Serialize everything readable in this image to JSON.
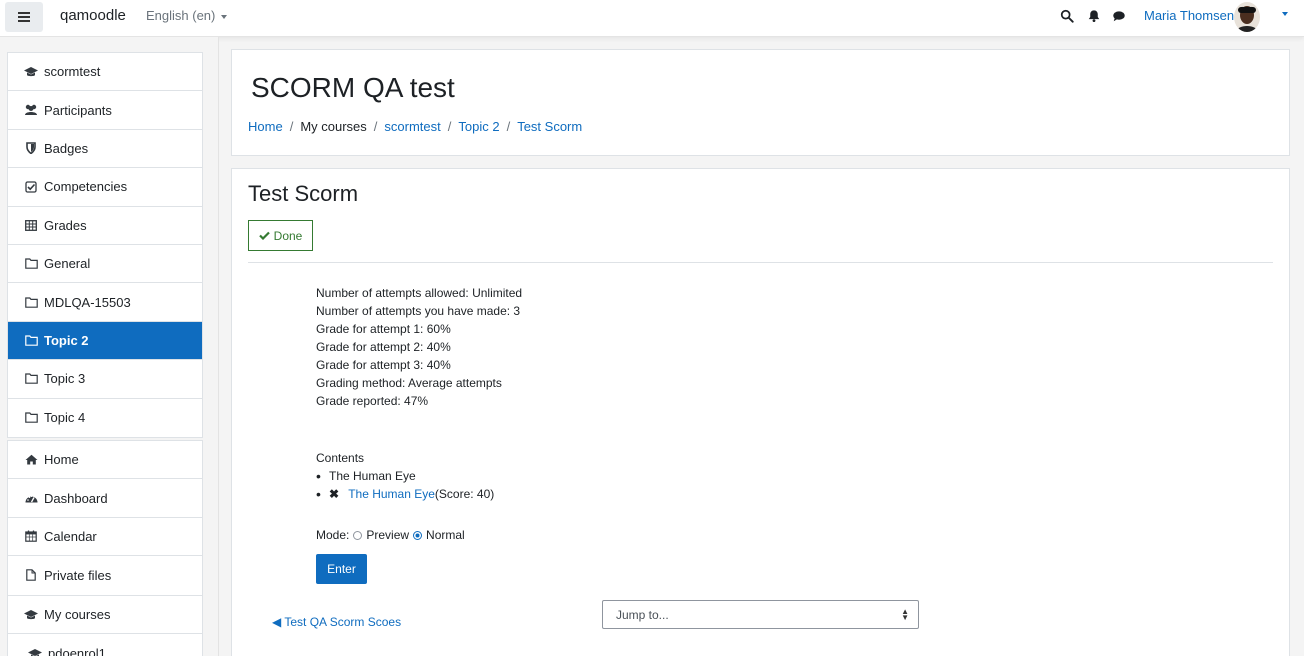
{
  "navbar": {
    "brand": "qamoodle",
    "language": "English (en)",
    "user_name": "Maria Thomsen",
    "icons": [
      "menu-icon",
      "search-icon",
      "bell-icon",
      "chat-icon",
      "avatar",
      "chevron-down-icon"
    ]
  },
  "sidebar": {
    "course_items": [
      {
        "label": "scormtest",
        "icon": "graduation-cap-icon"
      },
      {
        "label": "Participants",
        "icon": "users-icon"
      },
      {
        "label": "Badges",
        "icon": "shield-icon"
      },
      {
        "label": "Competencies",
        "icon": "checkbox-icon"
      },
      {
        "label": "Grades",
        "icon": "table-icon"
      },
      {
        "label": "General",
        "icon": "folder-icon"
      },
      {
        "label": "MDLQA-15503",
        "icon": "folder-icon"
      },
      {
        "label": "Topic 2",
        "icon": "folder-icon",
        "active": true
      },
      {
        "label": "Topic 3",
        "icon": "folder-icon"
      },
      {
        "label": "Topic 4",
        "icon": "folder-icon"
      }
    ],
    "site_items": [
      {
        "label": "Home",
        "icon": "home-icon"
      },
      {
        "label": "Dashboard",
        "icon": "dashboard-icon"
      },
      {
        "label": "Calendar",
        "icon": "calendar-icon"
      },
      {
        "label": "Private files",
        "icon": "file-icon"
      }
    ],
    "my_courses": {
      "label": "My courses",
      "items": [
        {
          "label": "pdoenrol1"
        }
      ]
    }
  },
  "header": {
    "title": "SCORM QA test",
    "breadcrumb": [
      "Home",
      "My courses",
      "scormtest",
      "Topic 2",
      "Test Scorm"
    ]
  },
  "activity": {
    "title": "Test Scorm",
    "done_label": "Done",
    "info": [
      "Number of attempts allowed: Unlimited",
      "Number of attempts you have made: 3",
      "Grade for attempt 1: 60%",
      "Grade for attempt 2: 40%",
      "Grade for attempt 3: 40%",
      "Grading method: Average attempts",
      "Grade reported: 47%"
    ],
    "contents_label": "Contents",
    "contents_item1": "The Human Eye",
    "contents_item2_link": "The Human Eye",
    "contents_item2_score": "(Score: 40)",
    "mode_label": "Mode:",
    "mode_preview": "Preview",
    "mode_normal": "Normal",
    "mode_selected": "Normal",
    "enter_label": "Enter",
    "prev_link": "Test QA Scorm Scoes",
    "jump_placeholder": "Jump to..."
  },
  "colors": {
    "primary": "#0f6cbf",
    "success": "#357a32",
    "page_bg": "#f4f4f4"
  }
}
